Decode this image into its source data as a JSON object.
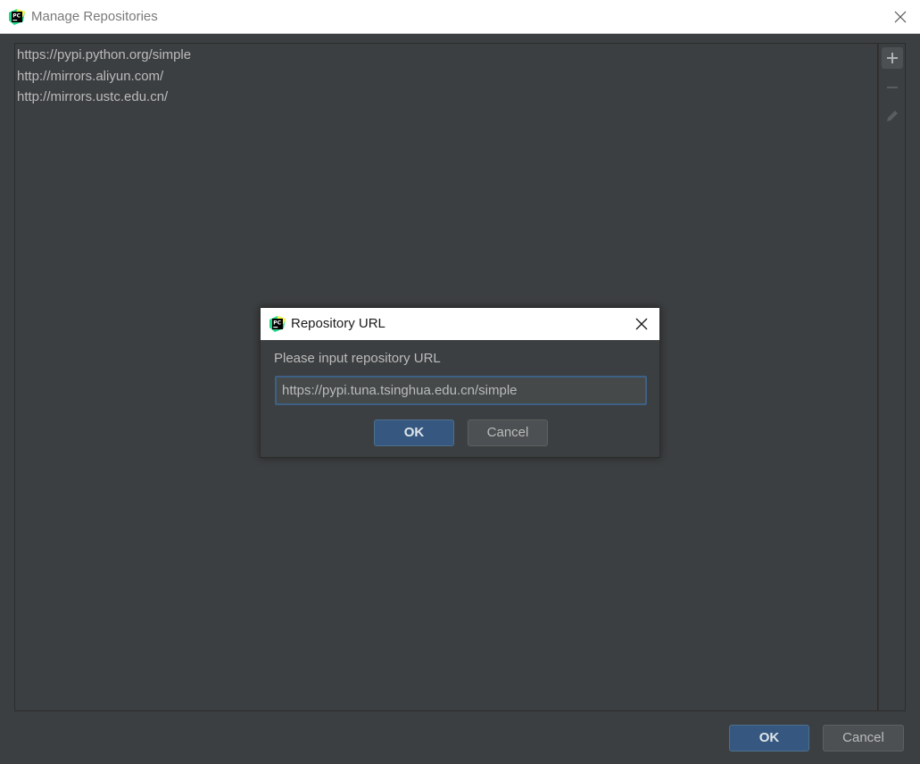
{
  "window": {
    "title": "Manage Repositories"
  },
  "repositories": [
    "https://pypi.python.org/simple",
    "http://mirrors.aliyun.com/",
    "http://mirrors.ustc.edu.cn/"
  ],
  "toolbar": {
    "add_icon": "plus-icon",
    "remove_icon": "minus-icon",
    "edit_icon": "pencil-icon"
  },
  "footer": {
    "ok_label": "OK",
    "cancel_label": "Cancel"
  },
  "dialog": {
    "title": "Repository URL",
    "prompt": "Please input repository URL",
    "url_value": "https://pypi.tuna.tsinghua.edu.cn/simple",
    "ok_label": "OK",
    "cancel_label": "Cancel"
  },
  "colors": {
    "background": "#3c3f41",
    "primary_button": "#365880",
    "focus_border": "#3d6185",
    "text": "#bbbbbb"
  }
}
